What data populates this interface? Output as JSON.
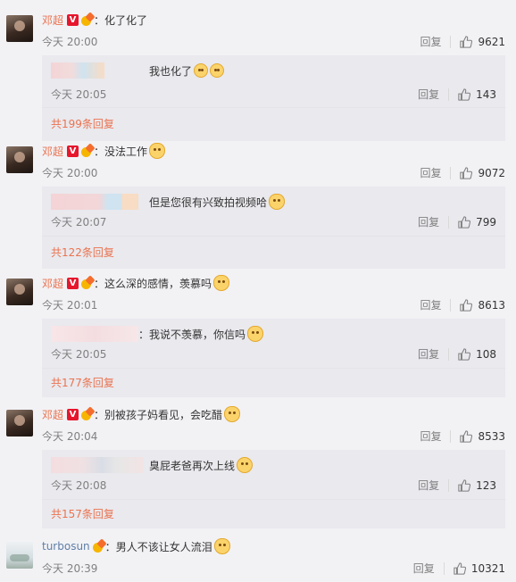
{
  "comments": [
    {
      "user": "邓超",
      "text": "化了化了",
      "time": "今天 20:00",
      "reply_label": "回复",
      "likes": "9621",
      "reply": {
        "text": "我也化了",
        "time": "今天 20:05",
        "reply_label": "回复",
        "likes": "143"
      },
      "more": "共199条回复"
    },
    {
      "user": "邓超",
      "text": "没法工作",
      "time": "今天 20:00",
      "reply_label": "回复",
      "likes": "9072",
      "reply": {
        "text": "但是您很有兴致拍视频哈",
        "time": "今天 20:07",
        "reply_label": "回复",
        "likes": "799"
      },
      "more": "共122条回复"
    },
    {
      "user": "邓超",
      "text": "这么深的感情，羡慕吗",
      "time": "今天 20:01",
      "reply_label": "回复",
      "likes": "8613",
      "reply": {
        "text": "我说不羡慕，你信吗",
        "time": "今天 20:05",
        "reply_label": "回复",
        "likes": "108"
      },
      "more": "共177条回复"
    },
    {
      "user": "邓超",
      "text": "别被孩子妈看见，会吃醋",
      "time": "今天 20:04",
      "reply_label": "回复",
      "likes": "8533",
      "reply": {
        "text": "臭屁老爸再次上线",
        "time": "今天 20:08",
        "reply_label": "回复",
        "likes": "123"
      },
      "more": "共157条回复"
    },
    {
      "user": "turbosun",
      "text": "男人不该让女人流泪",
      "time": "今天 20:39",
      "reply_label": "回复",
      "likes": "10321"
    }
  ],
  "badges": {
    "verified": "V"
  },
  "colors": {
    "username": "#eb7350",
    "username_alt": "#5f7ea6",
    "background": "#f2f2f5",
    "reply_box": "#e9e9ee"
  },
  "icons": [
    "thumbs-up-icon",
    "emoji-icon",
    "verified-badge-icon",
    "vip-crown-icon"
  ]
}
